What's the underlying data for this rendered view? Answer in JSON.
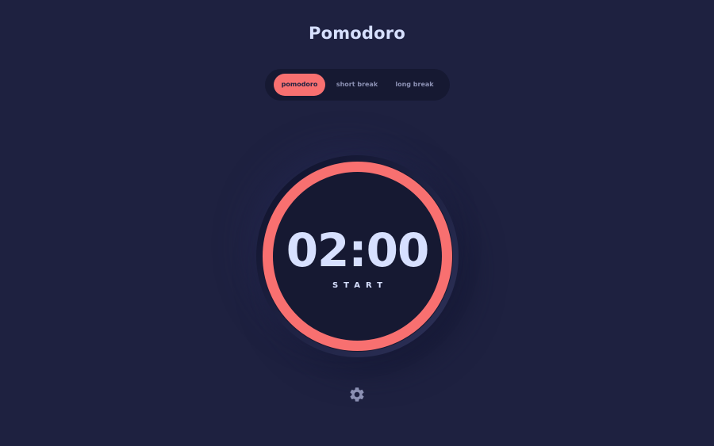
{
  "app": {
    "title": "Pomodoro"
  },
  "modes": [
    {
      "label": "pomodoro",
      "active": true
    },
    {
      "label": "short break",
      "active": false
    },
    {
      "label": "long break",
      "active": false
    }
  ],
  "timer": {
    "time": "02:00",
    "action_label": "START",
    "progress": 1.0
  },
  "settings": {
    "icon": "gear-icon"
  },
  "colors": {
    "background": "#1e2140",
    "panel": "#161932",
    "accent": "#f87070",
    "text": "#d7e0ff",
    "muted": "#8b90b3"
  }
}
